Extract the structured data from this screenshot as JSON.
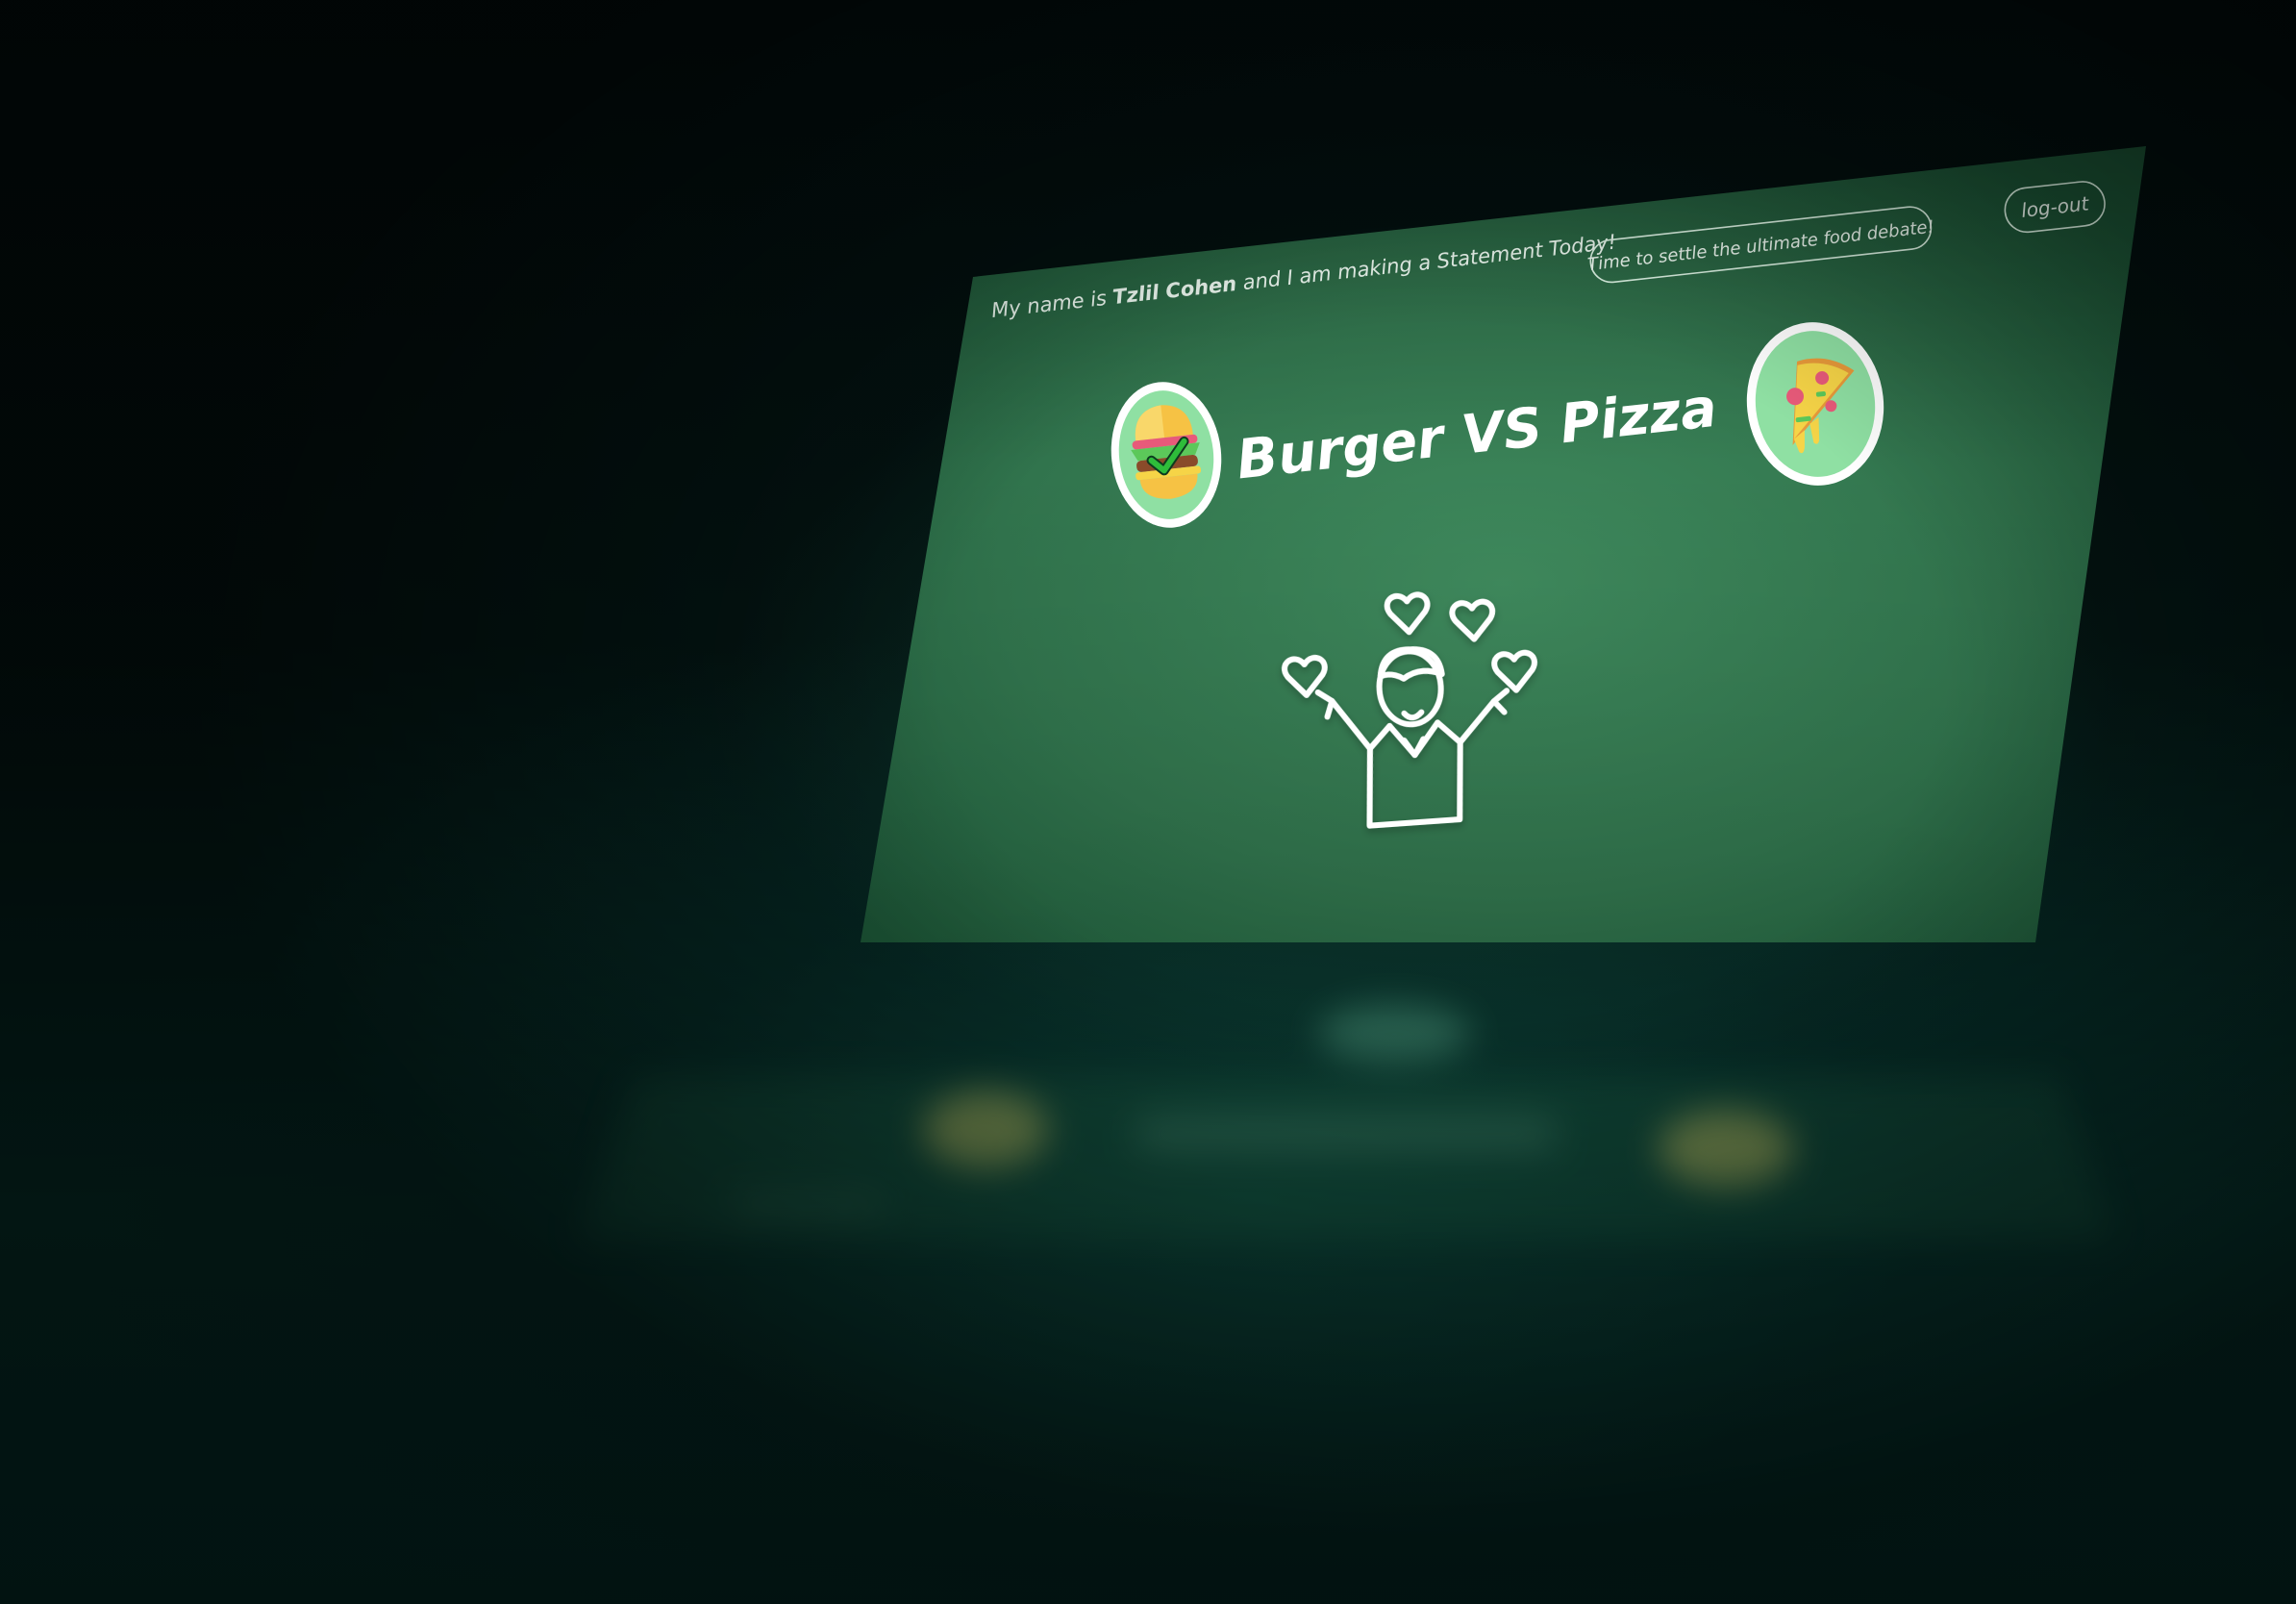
{
  "header": {
    "greeting_prefix": "My name is ",
    "user_name": "Tzlil Cohen",
    "greeting_suffix": " and I am making a Statement Today!",
    "tagline": "Time to settle the ultimate food debate!",
    "logout_label": "log-out"
  },
  "main": {
    "title": "Burger VS Pizza",
    "options": [
      {
        "name": "burger",
        "icon": "burger-icon",
        "selected": true
      },
      {
        "name": "pizza",
        "icon": "pizza-icon",
        "selected": false
      }
    ],
    "celebration_icon": "celebrating-person-with-hearts-icon"
  },
  "colors": {
    "screen_top": "#1f5e3c",
    "screen_center": "#3f8a5d",
    "screen_bottom": "#2a6d47",
    "circle_fill": "#8fe0a3",
    "accent_yellow": "#f6d447",
    "check_green": "#2ebd3a",
    "text": "#ffffff"
  }
}
